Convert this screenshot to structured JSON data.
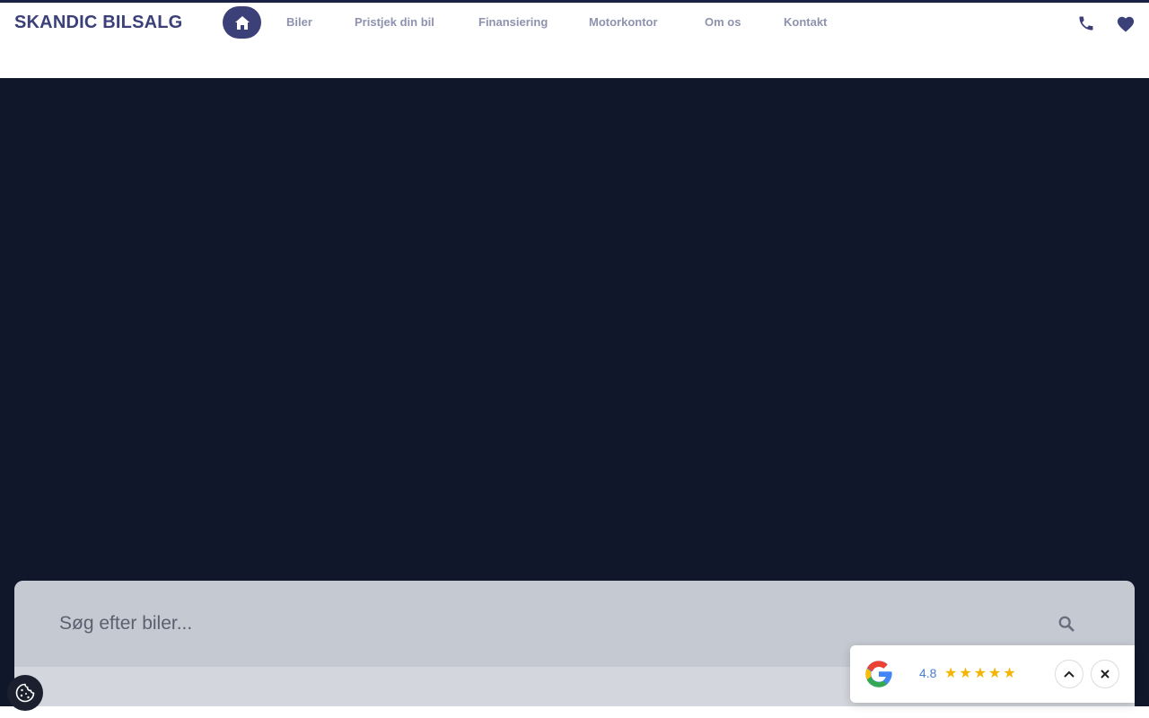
{
  "brand": {
    "name": "SKANDIC BILSALG"
  },
  "nav": {
    "home_icon": "home-icon",
    "items": [
      {
        "label": "Biler"
      },
      {
        "label": "Pristjek din bil"
      },
      {
        "label": "Finansiering"
      },
      {
        "label": "Motorkontor"
      },
      {
        "label": "Om os"
      },
      {
        "label": "Kontakt"
      }
    ]
  },
  "header_icons": {
    "phone": "phone-icon",
    "favorites": "heart-icon"
  },
  "search": {
    "placeholder": "Søg efter biler...",
    "value": "",
    "icon": "search-icon"
  },
  "review_widget": {
    "rating": "4.8",
    "stars": "★★★★★",
    "star_count": 5
  },
  "colors": {
    "brand": "#3b4178",
    "hero_bg": "#10172a",
    "nav_text": "#8e92ae",
    "star": "#f4b400"
  }
}
